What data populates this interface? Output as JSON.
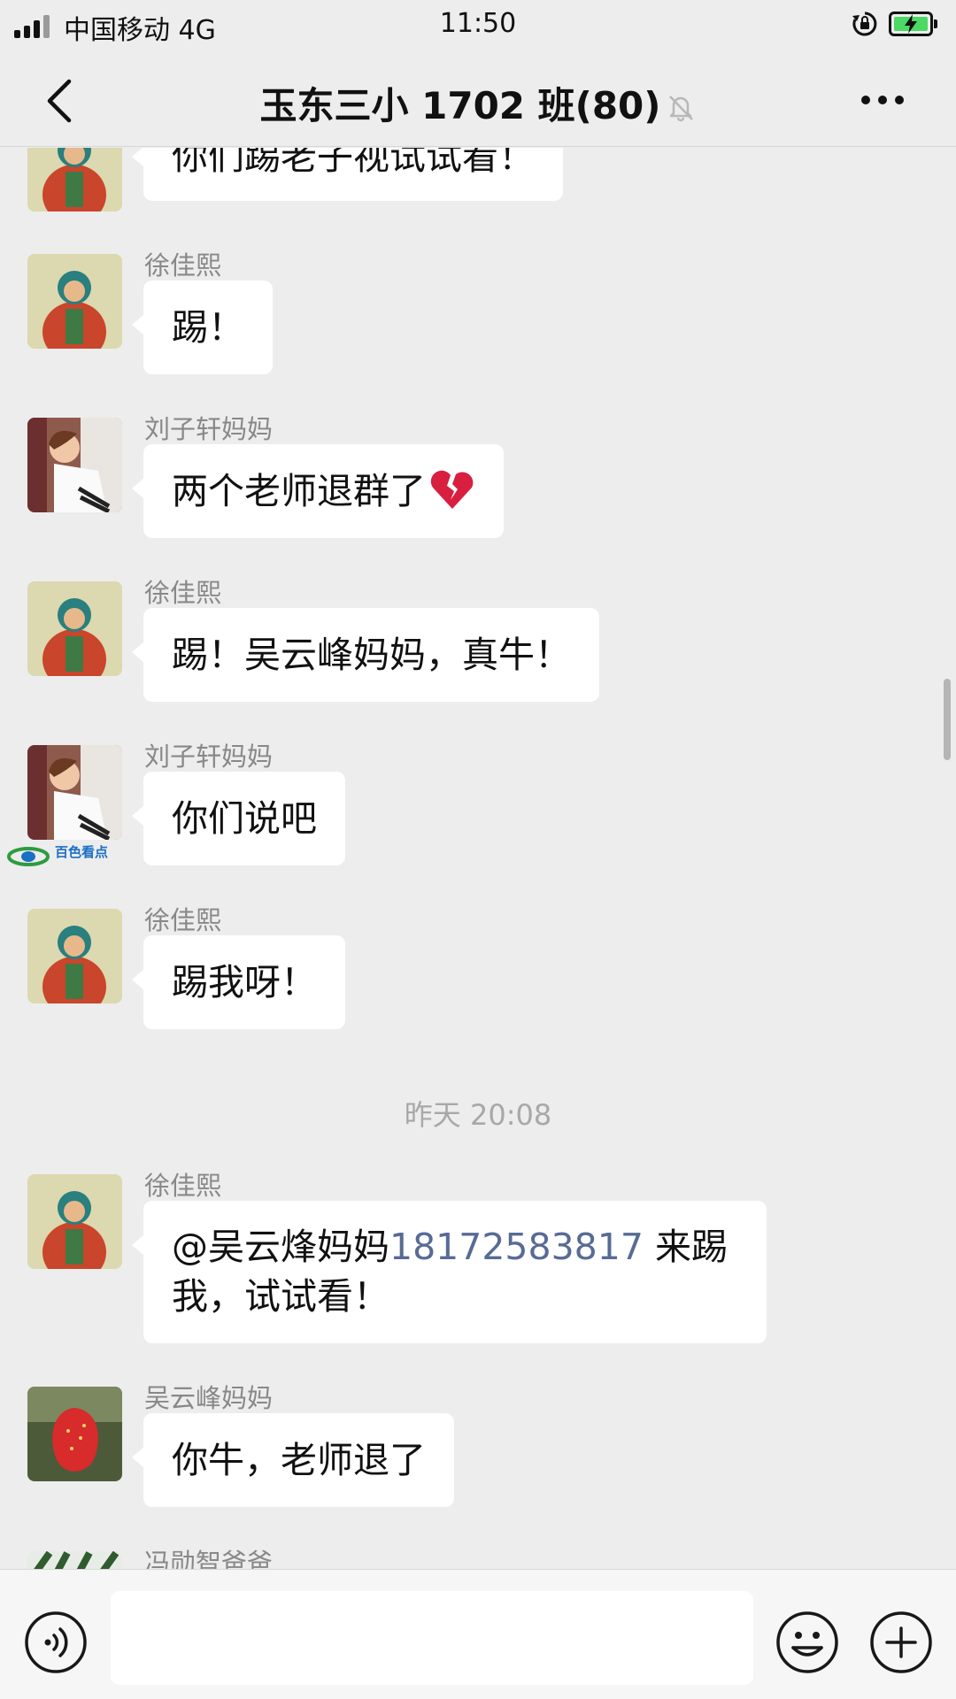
{
  "status_bar": {
    "carrier": "中国移动 4G",
    "time": "11:50"
  },
  "header": {
    "title": "玉东三小 1702 班(80)",
    "icons": [
      "back-chevron-icon",
      "mute-bell-icon",
      "more-dots-icon"
    ]
  },
  "messages": [
    {
      "sender": "",
      "text": "你们踢老子视试试看！",
      "avatar": "buddha-painting"
    },
    {
      "sender": "徐佳熙",
      "text": "踢！",
      "avatar": "buddha-painting"
    },
    {
      "sender": "刘子轩妈妈",
      "text": "两个老师退群了",
      "emoji": "broken-heart-icon",
      "avatar": "woman-photo"
    },
    {
      "sender": "徐佳熙",
      "text": "踢！吴云峰妈妈，真牛！",
      "avatar": "buddha-painting"
    },
    {
      "sender": "刘子轩妈妈",
      "text": "你们说吧",
      "avatar": "woman-photo"
    },
    {
      "sender": "徐佳熙",
      "text": "踢我呀！",
      "avatar": "buddha-painting"
    },
    {
      "sender": "徐佳熙",
      "mention": "@吴云烽妈妈",
      "phone": "18172583817",
      "text_after": " 来踢",
      "text_line2": "我，试试看！",
      "avatar": "buddha-painting"
    },
    {
      "sender": "吴云峰妈妈",
      "text": "你牛，老师退了",
      "avatar": "strawberry-photo"
    },
    {
      "sender": "冯勋智爸爸",
      "avatar": "plant-photo"
    }
  ],
  "time_divider": "昨天 20:08",
  "watermark": "百色看点",
  "input_bar": {
    "placeholder": "",
    "icons": [
      "voice-icon",
      "emoji-icon",
      "plus-icon"
    ]
  },
  "colors": {
    "background": "#ededed",
    "bubble": "#ffffff",
    "link": "#576b95",
    "sender_name": "#888888",
    "battery": "#4cd964"
  }
}
